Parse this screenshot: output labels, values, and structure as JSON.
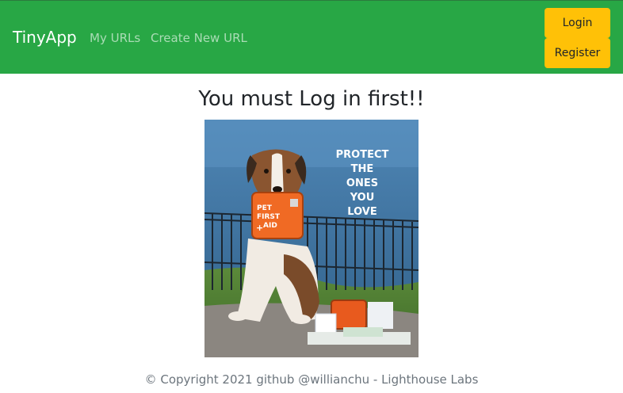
{
  "nav": {
    "brand": "TinyApp",
    "links": [
      "My URLs",
      "Create New URL"
    ],
    "login_label": "Login",
    "register_label": "Register",
    "colors": {
      "navbar": "#28a745",
      "button": "#ffc107"
    }
  },
  "main": {
    "heading": "You must Log in first!!",
    "image": {
      "poster_text": [
        "PROTECT",
        "THE",
        "ONES",
        "YOU",
        "LOVE"
      ],
      "bag_text": [
        "PET",
        "FIRST",
        "AID"
      ]
    }
  },
  "footer": {
    "text": "© Copyright 2021 github @willianchu - Lighthouse Labs"
  }
}
